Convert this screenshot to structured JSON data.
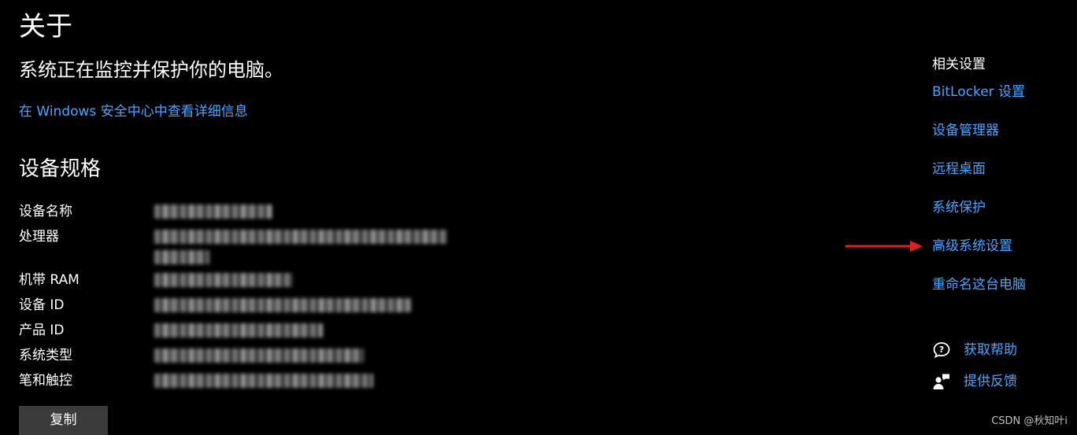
{
  "page": {
    "title": "关于",
    "status": "系统正在监控并保护你的电脑。",
    "security_link": "在 Windows 安全中心中查看详细信息"
  },
  "specs": {
    "heading": "设备规格",
    "rows": [
      {
        "label": "设备名称"
      },
      {
        "label": "处理器"
      },
      {
        "label": "机带 RAM"
      },
      {
        "label": "设备 ID"
      },
      {
        "label": "产品 ID"
      },
      {
        "label": "系统类型"
      },
      {
        "label": "笔和触控"
      }
    ],
    "copy_label": "复制"
  },
  "related": {
    "heading": "相关设置",
    "links": [
      "BitLocker 设置",
      "设备管理器",
      "远程桌面",
      "系统保护",
      "高级系统设置",
      "重命名这台电脑"
    ]
  },
  "help": {
    "get_help": "获取帮助",
    "feedback": "提供反馈"
  },
  "watermark": "CSDN @秋知叶i",
  "colors": {
    "background": "#000000",
    "link": "#4aa3ff",
    "button": "#3b3b3b",
    "arrow": "#e02020"
  },
  "icons": {
    "help": "chat-question-icon",
    "feedback": "person-feedback-icon",
    "pointer": "red-arrow-icon"
  }
}
